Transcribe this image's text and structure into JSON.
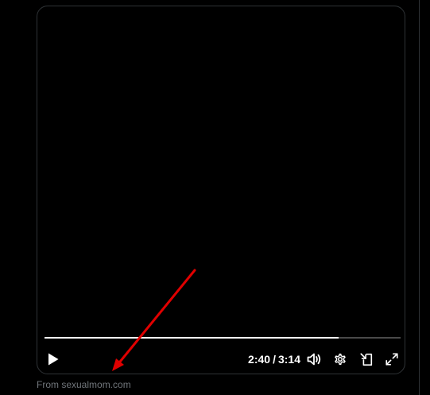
{
  "player": {
    "current_time": "2:40",
    "separator": "/",
    "duration": "3:14",
    "progress_fraction": 0.826
  },
  "controls": {
    "play_icon": "play-icon",
    "volume_icon": "volume-icon",
    "settings_icon": "gear-icon",
    "pip_icon": "picture-in-picture-icon",
    "fullscreen_icon": "expand-icon"
  },
  "source": {
    "text": "From sexualmom.com"
  },
  "annotation": {
    "color": "#e00000"
  },
  "colors": {
    "background": "#000000",
    "border": "#2f3336",
    "source_text": "#71767b",
    "progress_fill": "#f2f2f2",
    "progress_track": "#4a4a4a"
  }
}
